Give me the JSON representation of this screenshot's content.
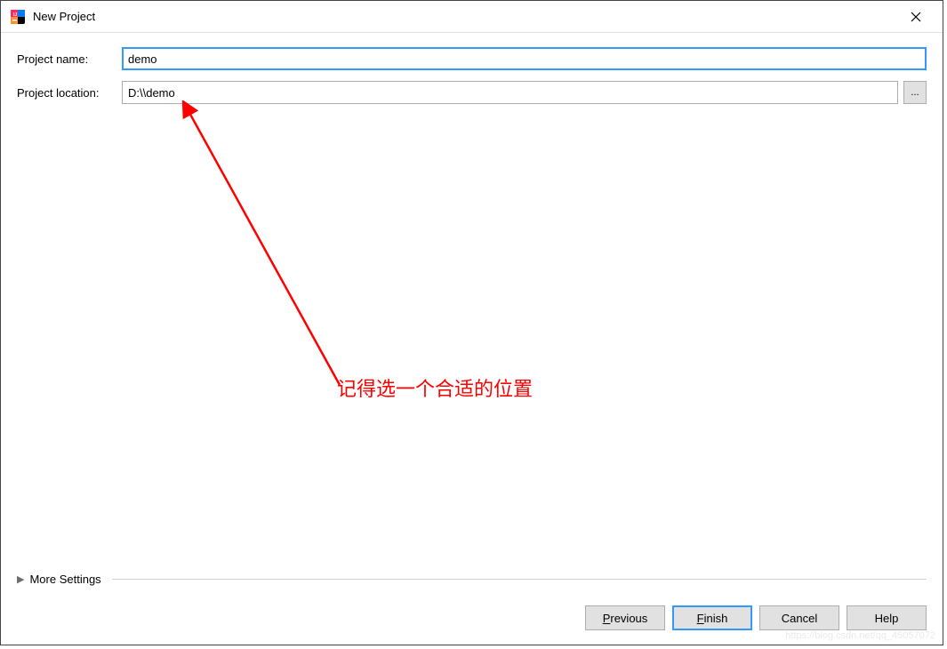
{
  "window": {
    "title": "New Project"
  },
  "form": {
    "projectNameLabel": "Project name:",
    "projectNameValue": "demo",
    "projectLocationLabel": "Project location:",
    "projectLocationValue": "D:\\\\demo",
    "browseLabel": "..."
  },
  "annotation": {
    "text": "记得选一个合适的位置"
  },
  "moreSettings": {
    "label": "More Settings"
  },
  "buttons": {
    "previous_pre": "P",
    "previous_post": "revious",
    "finish_pre": "F",
    "finish_post": "inish",
    "cancel": "Cancel",
    "help": "Help"
  },
  "watermark": "https://blog.csdn.net/qq_45057072"
}
